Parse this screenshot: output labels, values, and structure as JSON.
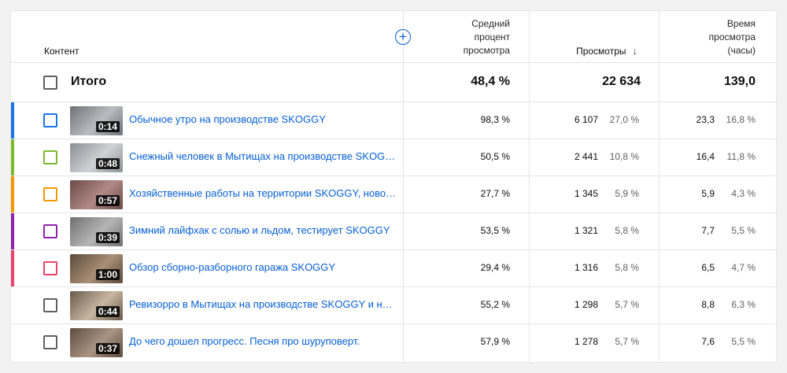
{
  "header": {
    "content_label": "Контент",
    "add_column_glyph": "+",
    "avg_percent_label": "Средний\nпроцент\nпросмотра",
    "views_label": "Просмотры",
    "views_sort_glyph": "↓",
    "watch_time_label": "Время\nпросмотра\n(часы)"
  },
  "total": {
    "label": "Итого",
    "avg_percent": "48,4 %",
    "views": "22 634",
    "watch_time": "139,0"
  },
  "rows": [
    {
      "title": "Обычное утро на производстве SKOGGY",
      "duration": "0:14",
      "avg_percent": "98,3 %",
      "views": "6 107",
      "views_pct": "27,0 %",
      "watch_time": "23,3",
      "watch_time_pct": "16,8 %",
      "color": "#1a73e8",
      "thumb_a": "#6e7278",
      "thumb_b": "#b9bcc0"
    },
    {
      "title": "Снежный человек в Мытищах на производстве SKOGGY",
      "duration": "0:48",
      "avg_percent": "50,5 %",
      "views": "2 441",
      "views_pct": "10,8 %",
      "watch_time": "16,4",
      "watch_time_pct": "11,8 %",
      "color": "#7cb82f",
      "thumb_a": "#8a8f94",
      "thumb_b": "#cfd2d5"
    },
    {
      "title": "Хозяйственные работы на территории SKOGGY, новости",
      "duration": "0:57",
      "avg_percent": "27,7 %",
      "views": "1 345",
      "views_pct": "5,9 %",
      "watch_time": "5,9",
      "watch_time_pct": "4,3 %",
      "color": "#f29900",
      "thumb_a": "#6b4a46",
      "thumb_b": "#b08a86"
    },
    {
      "title": "Зимний лайфхак с солью и льдом, тестирует SKOGGY",
      "duration": "0:39",
      "avg_percent": "53,5 %",
      "views": "1 321",
      "views_pct": "5,8 %",
      "watch_time": "7,7",
      "watch_time_pct": "5,5 %",
      "color": "#8e24aa",
      "thumb_a": "#707070",
      "thumb_b": "#b5b5b5"
    },
    {
      "title": "Обзор сборно-разборного гаража SKOGGY",
      "duration": "1:00",
      "avg_percent": "29,4 %",
      "views": "1 316",
      "views_pct": "5,8 %",
      "watch_time": "6,5",
      "watch_time_pct": "4,7 %",
      "color": "#e8436b",
      "thumb_a": "#5c4a3a",
      "thumb_b": "#a88f76"
    },
    {
      "title": "Ревизорро в Мытищах на производстве SKOGGY и новости",
      "duration": "0:44",
      "avg_percent": "55,2 %",
      "views": "1 298",
      "views_pct": "5,7 %",
      "watch_time": "8,8",
      "watch_time_pct": "6,3 %",
      "color": "",
      "thumb_a": "#6a5a4c",
      "thumb_b": "#c8b7a2"
    },
    {
      "title": "До чего дошел прогресс. Песня про шуруповерт.",
      "duration": "0:37",
      "avg_percent": "57,9 %",
      "views": "1 278",
      "views_pct": "5,7 %",
      "watch_time": "7,6",
      "watch_time_pct": "5,5 %",
      "color": "",
      "thumb_a": "#5e4c40",
      "thumb_b": "#a99484"
    }
  ]
}
